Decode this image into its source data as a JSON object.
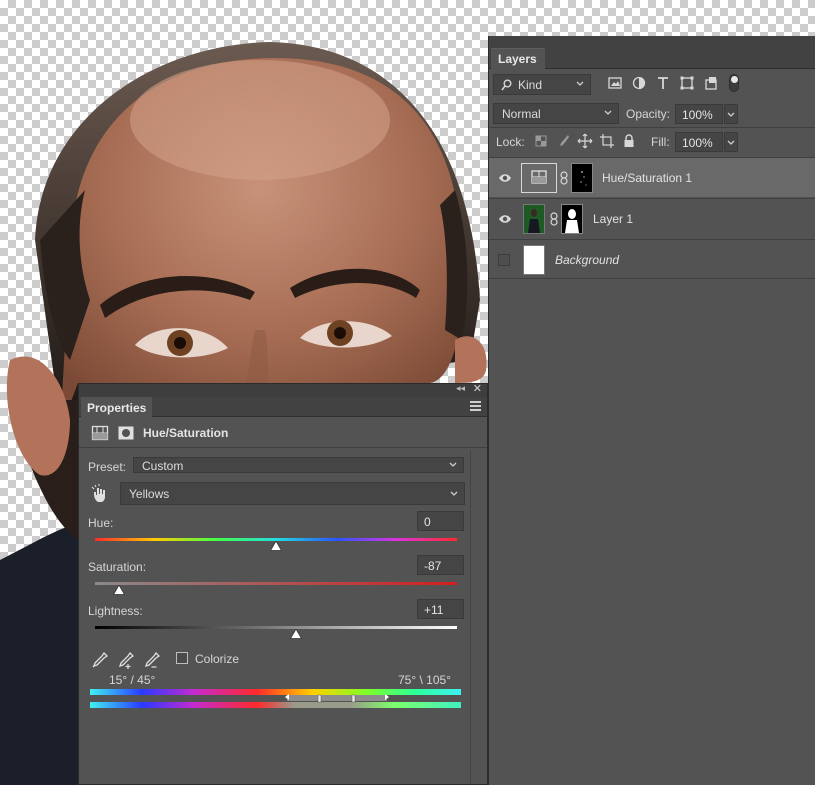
{
  "layers_panel": {
    "tab": "Layers",
    "filter_kind": "Kind",
    "blend_mode": "Normal",
    "opacity_label": "Opacity:",
    "opacity_value": "100%",
    "lock_label": "Lock:",
    "fill_label": "Fill:",
    "fill_value": "100%",
    "layers": [
      {
        "name": "Hue/Saturation 1",
        "visible": true,
        "selected": true,
        "italic": false
      },
      {
        "name": "Layer 1",
        "visible": true,
        "selected": false,
        "italic": false
      },
      {
        "name": "Background",
        "visible": false,
        "selected": false,
        "italic": true
      }
    ]
  },
  "properties_panel": {
    "tab": "Properties",
    "title": "Hue/Saturation",
    "preset_label": "Preset:",
    "preset_value": "Custom",
    "channel_value": "Yellows",
    "hue": {
      "label": "Hue:",
      "value": "0",
      "position": 0.5
    },
    "saturation": {
      "label": "Saturation:",
      "value": "-87",
      "position": 0.065
    },
    "lightness": {
      "label": "Lightness:",
      "value": "+11",
      "position": 0.555
    },
    "colorize_label": "Colorize",
    "colorize_checked": false,
    "range_left": "15° / 45°",
    "range_right": "75° \\ 105°"
  },
  "colors": {
    "panel_bg": "#535353",
    "field_bg": "#454545",
    "selected_row": "#696969"
  }
}
